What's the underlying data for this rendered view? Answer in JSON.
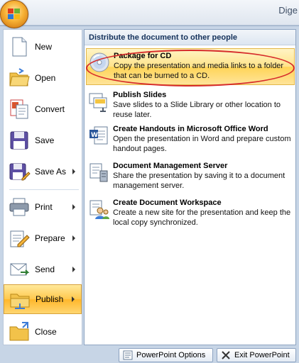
{
  "window": {
    "title_partial": "Dige"
  },
  "office_button": {
    "icon": "office-logo-icon"
  },
  "commands": [
    {
      "label": "New",
      "icon": "new-document-icon",
      "has_submenu": false
    },
    {
      "label": "Open",
      "icon": "open-folder-icon",
      "has_submenu": false
    },
    {
      "label": "Convert",
      "icon": "convert-icon",
      "has_submenu": false
    },
    {
      "label": "Save",
      "icon": "save-disk-icon",
      "has_submenu": false
    },
    {
      "label": "Save As",
      "icon": "save-as-icon",
      "has_submenu": true
    },
    {
      "label": "Print",
      "icon": "printer-icon",
      "has_submenu": true
    },
    {
      "label": "Prepare",
      "icon": "prepare-pencil-icon",
      "has_submenu": true
    },
    {
      "label": "Send",
      "icon": "send-icon",
      "has_submenu": true
    },
    {
      "label": "Publish",
      "icon": "publish-icon",
      "has_submenu": true,
      "active": true
    },
    {
      "label": "Close",
      "icon": "close-folder-icon",
      "has_submenu": false
    }
  ],
  "submenu": {
    "header": "Distribute the document to other people",
    "items": [
      {
        "title": "Package for CD",
        "desc": "Copy the presentation and media links to a folder that can be burned to a CD.",
        "icon": "cd-icon",
        "active": true
      },
      {
        "title": "Publish Slides",
        "desc": "Save slides to a Slide Library or other location to reuse later.",
        "icon": "slides-library-icon"
      },
      {
        "title": "Create Handouts in Microsoft Office Word",
        "desc": "Open the presentation in Word and prepare custom handout pages.",
        "icon": "word-handouts-icon"
      },
      {
        "title": "Document Management Server",
        "desc": "Share the presentation by saving it to a document management server.",
        "icon": "document-server-icon"
      },
      {
        "title": "Create Document Workspace",
        "desc": "Create a new site for the presentation and keep the local copy synchronized.",
        "icon": "workspace-people-icon"
      }
    ]
  },
  "footer": {
    "options_label": "PowerPoint Options",
    "exit_label": "Exit PowerPoint"
  },
  "colors": {
    "highlight": "#ffc84d",
    "annotation_ring": "#d62b2b",
    "frame": "#c7d5e6"
  }
}
